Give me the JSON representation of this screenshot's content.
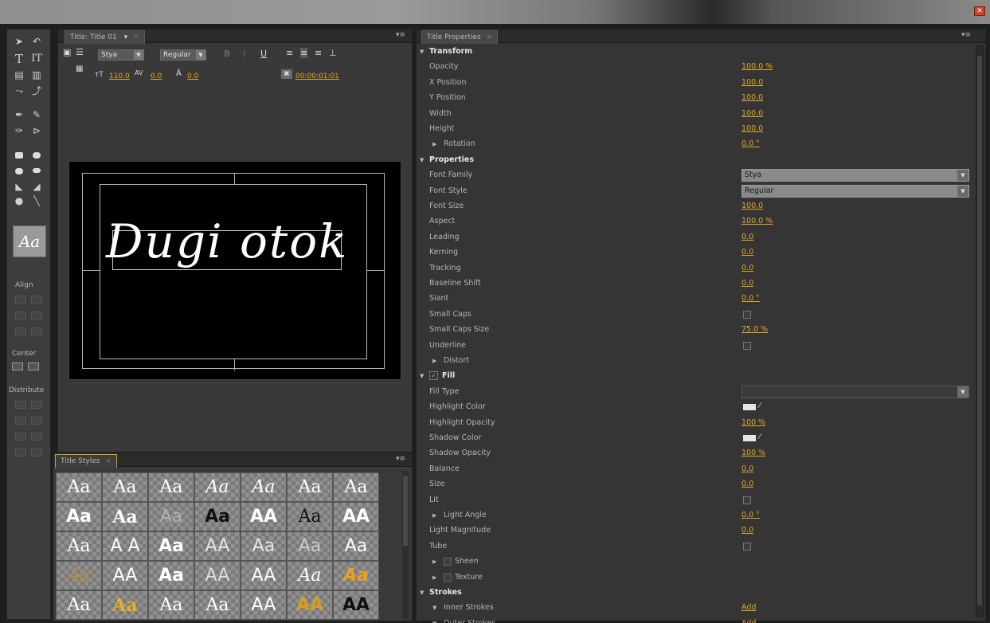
{
  "window": {
    "close_icon": "close-icon"
  },
  "title_panel": {
    "tab": "Title: Title 01",
    "font_family": "Stya",
    "font_style": "Regular",
    "bold": "B",
    "italic": "I",
    "underline": "U",
    "font_size": "110.0",
    "kerning": "0.0",
    "leading": "0.0",
    "timecode": "00:00:01:01",
    "canvas_text": "Dugi otok"
  },
  "tools": {
    "align_label": "Align",
    "center_label": "Center",
    "distribute_label": "Distribute",
    "preview_text": "Aa"
  },
  "styles_panel": {
    "tab": "Title Styles",
    "swatches": [
      {
        "text": "Aa",
        "font": "serif",
        "color": "#ffffff",
        "style": "normal"
      },
      {
        "text": "Aa",
        "font": "serif",
        "color": "#ffffff",
        "style": "normal"
      },
      {
        "text": "Aa",
        "font": "serif",
        "color": "#ffffff",
        "style": "normal"
      },
      {
        "text": "Aa",
        "font": "serif",
        "color": "#ffffff",
        "style": "italic"
      },
      {
        "text": "Aa",
        "font": "serif",
        "color": "#ffffff",
        "style": "italic"
      },
      {
        "text": "Aa",
        "font": "serif",
        "color": "#ffffff",
        "style": "normal"
      },
      {
        "text": "Aa",
        "font": "serif",
        "color": "#ffffff",
        "style": "normal"
      },
      {
        "text": "Aa",
        "font": "sans",
        "color": "#ffffff",
        "style": "bold"
      },
      {
        "text": "Aa",
        "font": "serif",
        "color": "#ffffff",
        "style": "bold"
      },
      {
        "text": "Aa",
        "font": "sans",
        "color": "#b0b0b0",
        "style": "normal"
      },
      {
        "text": "Aa",
        "font": "sans",
        "color": "#111111",
        "style": "bold"
      },
      {
        "text": "AA",
        "font": "sans",
        "color": "#ffffff",
        "style": "bold"
      },
      {
        "text": "Aa",
        "font": "serif",
        "color": "#111111",
        "style": "normal"
      },
      {
        "text": "AA",
        "font": "sans",
        "color": "#ffffff",
        "style": "bold"
      },
      {
        "text": "Aa",
        "font": "serif",
        "color": "#ffffff",
        "style": "normal"
      },
      {
        "text": "A A",
        "font": "sans",
        "color": "#ffffff",
        "style": "normal"
      },
      {
        "text": "Aa",
        "font": "sans",
        "color": "#ffffff",
        "style": "bold"
      },
      {
        "text": "AA",
        "font": "sans",
        "color": "#e6e6e6",
        "style": "normal"
      },
      {
        "text": "Aa",
        "font": "sans",
        "color": "#e6e6e6",
        "style": "normal"
      },
      {
        "text": "Aa",
        "font": "sans",
        "color": "#cccccc",
        "style": "normal"
      },
      {
        "text": "Aa",
        "font": "sans",
        "color": "#ffffff",
        "style": "normal"
      },
      {
        "text": "Aa",
        "font": "serif",
        "color": "#c08a3a",
        "style": "italic"
      },
      {
        "text": "AA",
        "font": "sans",
        "color": "#ffffff",
        "style": "normal"
      },
      {
        "text": "Aa",
        "font": "sans",
        "color": "#ffffff",
        "style": "bold"
      },
      {
        "text": "AA",
        "font": "sans",
        "color": "#dddddd",
        "style": "normal"
      },
      {
        "text": "AA",
        "font": "sans",
        "color": "#ffffff",
        "style": "normal"
      },
      {
        "text": "Aa",
        "font": "serif",
        "color": "#ffffff",
        "style": "italic"
      },
      {
        "text": "Aa",
        "font": "sans",
        "color": "#e8a21f",
        "style": "bold-italic"
      },
      {
        "text": "Aa",
        "font": "serif",
        "color": "#ffffff",
        "style": "normal"
      },
      {
        "text": "Aa",
        "font": "serif",
        "color": "#e8b020",
        "style": "bold"
      },
      {
        "text": "Aa",
        "font": "serif",
        "color": "#ffffff",
        "style": "normal"
      },
      {
        "text": "Aa",
        "font": "serif",
        "color": "#ffffff",
        "style": "normal"
      },
      {
        "text": "AA",
        "font": "sans",
        "color": "#ffffff",
        "style": "normal"
      },
      {
        "text": "AA",
        "font": "sans",
        "color": "#d4a020",
        "style": "bold"
      },
      {
        "text": "AA",
        "font": "sans",
        "color": "#111111",
        "style": "bold"
      }
    ]
  },
  "props_panel": {
    "tab": "Title Properties",
    "rows": [
      {
        "type": "section",
        "label": "Transform",
        "indent": 0,
        "arrow": "▼"
      },
      {
        "type": "value",
        "label": "Opacity",
        "value": "100.0 %"
      },
      {
        "type": "value",
        "label": "X Position",
        "value": "100.0"
      },
      {
        "type": "value",
        "label": "Y Position",
        "value": "100.0"
      },
      {
        "type": "value",
        "label": "Width",
        "value": "100.0"
      },
      {
        "type": "value",
        "label": "Height",
        "value": "100.0"
      },
      {
        "type": "value",
        "label": "Rotation",
        "value": "0.0 °",
        "arrow": "▶",
        "indent": 1
      },
      {
        "type": "section",
        "label": "Properties",
        "indent": 0,
        "arrow": "▼"
      },
      {
        "type": "select",
        "label": "Font Family",
        "value": "Stya"
      },
      {
        "type": "select",
        "label": "Font Style",
        "value": "Regular"
      },
      {
        "type": "value",
        "label": "Font Size",
        "value": "100.0"
      },
      {
        "type": "value",
        "label": "Aspect",
        "value": "100.0 %"
      },
      {
        "type": "value",
        "label": "Leading",
        "value": "0.0"
      },
      {
        "type": "value",
        "label": "Kerning",
        "value": "0.0"
      },
      {
        "type": "value",
        "label": "Tracking",
        "value": "0.0"
      },
      {
        "type": "value",
        "label": "Baseline Shift",
        "value": "0.0"
      },
      {
        "type": "value",
        "label": "Slant",
        "value": "0.0 °"
      },
      {
        "type": "checkbox",
        "label": "Small Caps"
      },
      {
        "type": "value",
        "label": "Small Caps Size",
        "value": "75.0 %"
      },
      {
        "type": "checkbox",
        "label": "Underline"
      },
      {
        "type": "plain",
        "label": "Distort",
        "arrow": "▶",
        "indent": 1
      },
      {
        "type": "section",
        "label": "Fill",
        "indent": 0,
        "arrow": "▼",
        "check": "✓"
      },
      {
        "type": "select-dark",
        "label": "Fill Type",
        "value": ""
      },
      {
        "type": "color",
        "label": "Highlight Color"
      },
      {
        "type": "value",
        "label": "Highlight Opacity",
        "value": "100 %"
      },
      {
        "type": "color",
        "label": "Shadow Color"
      },
      {
        "type": "value",
        "label": "Shadow Opacity",
        "value": "100 %"
      },
      {
        "type": "value",
        "label": "Balance",
        "value": "0.0"
      },
      {
        "type": "value",
        "label": "Size",
        "value": "0.0"
      },
      {
        "type": "checkbox",
        "label": "Lit"
      },
      {
        "type": "value",
        "label": "Light Angle",
        "value": "0.0 °",
        "arrow": "▶",
        "indent": 1
      },
      {
        "type": "value",
        "label": "Light Magnitude",
        "value": "0.0"
      },
      {
        "type": "checkbox",
        "label": "Tube"
      },
      {
        "type": "plain",
        "label": "Sheen",
        "arrow": "▶",
        "indent": 1,
        "box": true
      },
      {
        "type": "plain",
        "label": "Texture",
        "arrow": "▶",
        "indent": 1,
        "box": true
      },
      {
        "type": "section",
        "label": "Strokes",
        "indent": 0,
        "arrow": "▼"
      },
      {
        "type": "value",
        "label": "Inner Strokes",
        "value": "Add",
        "arrow": "▼",
        "indent": 1
      },
      {
        "type": "value",
        "label": "Outer Strokes",
        "value": "Add",
        "arrow": "▼",
        "indent": 1
      }
    ]
  }
}
